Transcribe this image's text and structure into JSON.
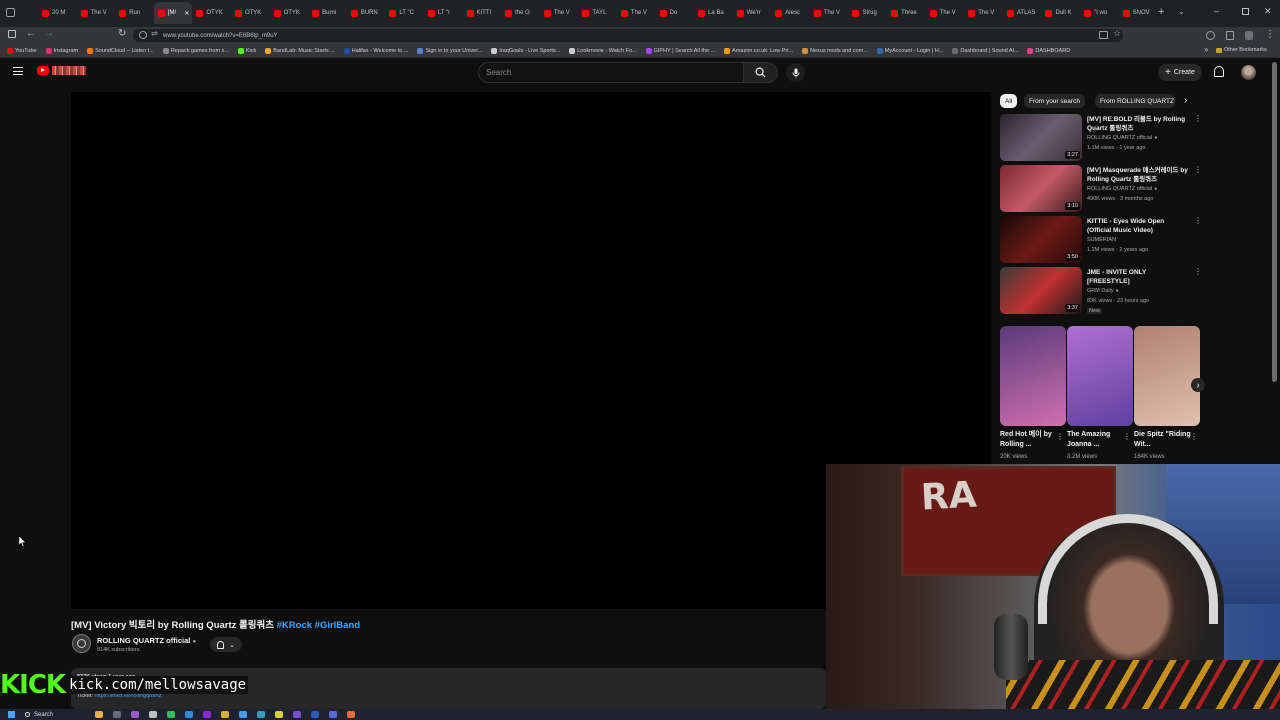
{
  "browser": {
    "tabs": [
      "20 M",
      "The V",
      "Run",
      "[M/",
      "OTYK",
      "OTYK",
      "OTYK",
      "Burni",
      "BURN",
      "LT \"C",
      "LT \"r",
      "KITTI",
      "the G",
      "The V",
      "TAYL",
      "The V",
      "Do",
      "La Ba",
      "We'rr",
      "Alesc",
      "The V",
      "Strug",
      "Three",
      "The V",
      "The V",
      "ATLAS",
      "Dull K",
      "\"I wo",
      "SNOV"
    ],
    "active_tab_index": 3,
    "url": "www.youtube.com/watch?v=E6B6tp_m9uY",
    "bookmarks": [
      {
        "label": "YouTube",
        "color": "#ff0000"
      },
      {
        "label": "Instagram",
        "color": "#e1306c"
      },
      {
        "label": "SoundCloud – Listen t...",
        "color": "#ff7700"
      },
      {
        "label": "Repack games from x...",
        "color": "#8a8a8a"
      },
      {
        "label": "Kick",
        "color": "#53fc18"
      },
      {
        "label": "BandLab: Music Starts ...",
        "color": "#f5a623"
      },
      {
        "label": "Halifax - Welcome to ...",
        "color": "#1c4fa0"
      },
      {
        "label": "Sign in to your Univer...",
        "color": "#5b7fd1"
      },
      {
        "label": "IraqGoals - Live Sports...",
        "color": "#cccccc"
      },
      {
        "label": "Lookmovie - Watch Fo...",
        "color": "#cccccc"
      },
      {
        "label": "GIPHY | Search All the ...",
        "color": "#a4f"
      },
      {
        "label": "Amazon.co.uk: Low Pri...",
        "color": "#ff9900"
      },
      {
        "label": "Nexus mods and com...",
        "color": "#d98f40"
      },
      {
        "label": "MyAccount - Login | H...",
        "color": "#2b6cb0"
      },
      {
        "label": "Dashboard | Sound Al...",
        "color": "#6b6b6b"
      },
      {
        "label": "DASHBOARD",
        "color": "#e53e8c"
      }
    ],
    "other_bookmarks": "Other Bookmarks"
  },
  "youtube": {
    "search_placeholder": "Search",
    "create_label": "Create",
    "filter_chips": [
      "All",
      "From your search",
      "From ROLLING QUARTZ"
    ],
    "recommendations": [
      {
        "title": "[MV] RE.BOLD 리볼드 by Rolling Quartz 롤링쿼츠",
        "channel": "ROLLING QUARTZ official",
        "verified": true,
        "meta": "1.1M views · 1 year ago",
        "duration": "3:27",
        "colors": [
          "#2a2530",
          "#6a5d70",
          "#3a2f35"
        ],
        "badge": ""
      },
      {
        "title": "[MV] Masquerade 매스커레이드 by Rolling Quartz 롤링쿼츠",
        "channel": "ROLLING QUARTZ official",
        "verified": true,
        "meta": "490K views · 3 months ago",
        "duration": "3:10",
        "colors": [
          "#7a2a35",
          "#c45a65",
          "#3a1a20"
        ],
        "badge": ""
      },
      {
        "title": "KITTIE - Eyes Wide Open (Official Music Video)",
        "channel": "SUMERIAN",
        "verified": false,
        "meta": "1.2M views · 2 years ago",
        "duration": "3:50",
        "colors": [
          "#1a0808",
          "#6a1a15",
          "#2a0a0a"
        ],
        "badge": ""
      },
      {
        "title": "JME - INVITE ONLY [FREESTYLE]",
        "channel": "GRM Daily",
        "verified": true,
        "meta": "83K views · 23 hours ago",
        "duration": "3:37",
        "colors": [
          "#3a3a3a",
          "#c23030",
          "#1a1a1a"
        ],
        "badge": "New"
      }
    ],
    "shorts": [
      {
        "title": "Red Hot 메이 by Rolling ...",
        "views": "20K views",
        "colors": [
          "#5a3a7a",
          "#d070b0"
        ]
      },
      {
        "title": "The Amazing Joanna ...",
        "views": "3.2M views",
        "colors": [
          "#b070d0",
          "#6040a0"
        ]
      },
      {
        "title": "Die Spitz \"Riding Wit...",
        "views": "164K views",
        "colors": [
          "#b08070",
          "#e0c0b0"
        ]
      }
    ],
    "video": {
      "title_main": "[MV] Victory 빅토리 by Rolling Quartz 롤링쿼츠 ",
      "title_tags": "#KRock #GirlBand",
      "channel": "ROLLING QUARTZ official",
      "subscribers": "814K subscribers",
      "desc_meta": "837K views  1 year ago",
      "ticket_label": "Ticket:",
      "ticket_link": "https://linktr.ee/rollingquartz"
    }
  },
  "overlay": {
    "kick_logo": "KICK",
    "kick_url": "kick.com/mellowsavage"
  },
  "taskbar": {
    "search_label": "Search"
  }
}
